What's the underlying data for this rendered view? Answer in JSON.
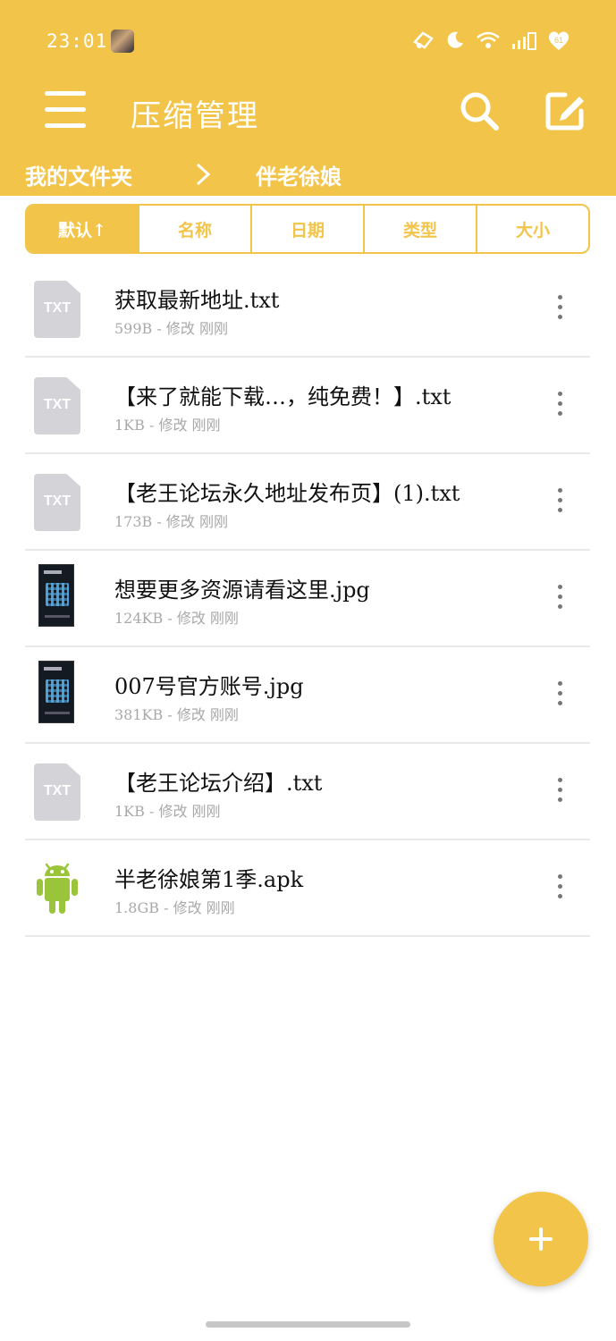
{
  "status_bar": {
    "time": "23:01",
    "icons": [
      "notification-icon",
      "moon-icon",
      "wifi-icon",
      "signal-icon",
      "battery-icon"
    ],
    "battery_level": "61"
  },
  "toolbar": {
    "title": "压缩管理",
    "menu_icon": "menu-icon",
    "search_icon": "search-icon",
    "edit_icon": "edit-icon"
  },
  "breadcrumb": {
    "root": "我的文件夹",
    "separator_icon": "chevron-right-icon",
    "current": "伴老徐娘"
  },
  "sort_tabs": [
    {
      "label": "默认↑",
      "active": true
    },
    {
      "label": "名称",
      "active": false
    },
    {
      "label": "日期",
      "active": false
    },
    {
      "label": "类型",
      "active": false
    },
    {
      "label": "大小",
      "active": false
    }
  ],
  "files": [
    {
      "name": "获取最新地址.txt",
      "meta": "599B - 修改 刚刚",
      "type": "txt",
      "icon_label": "TXT"
    },
    {
      "name": "【来了就能下载…，纯免费！】.txt",
      "meta": "1KB - 修改 刚刚",
      "type": "txt",
      "icon_label": "TXT"
    },
    {
      "name": "【老王论坛永久地址发布页】(1).txt",
      "meta": "173B - 修改 刚刚",
      "type": "txt",
      "icon_label": "TXT"
    },
    {
      "name": "想要更多资源请看这里.jpg",
      "meta": "124KB - 修改 刚刚",
      "type": "jpg",
      "icon_label": ""
    },
    {
      "name": "007号官方账号.jpg",
      "meta": "381KB - 修改 刚刚",
      "type": "jpg",
      "icon_label": ""
    },
    {
      "name": "【老王论坛介绍】.txt",
      "meta": "1KB - 修改 刚刚",
      "type": "txt",
      "icon_label": "TXT"
    },
    {
      "name": "半老徐娘第1季.apk",
      "meta": "1.8GB - 修改 刚刚",
      "type": "apk",
      "icon_label": ""
    }
  ],
  "colors": {
    "accent": "#f2c54a",
    "apk_green": "#9ac43a",
    "txt_icon_gray": "#d4d4d8",
    "meta_gray": "#a8a8a8"
  },
  "fab": {
    "icon": "plus-icon"
  }
}
